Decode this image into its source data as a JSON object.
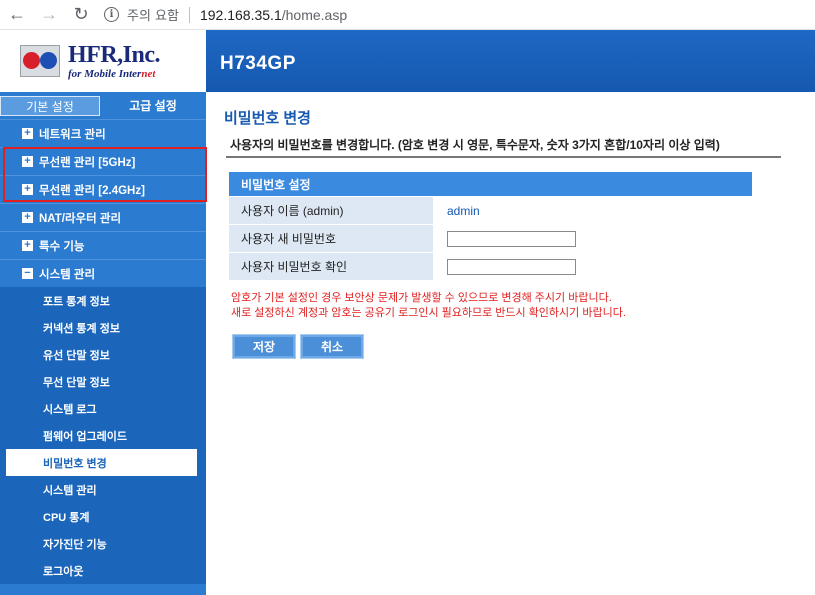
{
  "browser": {
    "security_label": "주의 요함",
    "url_host": "192.168.35.1",
    "url_path": "/home.asp"
  },
  "header": {
    "brand_name": "HFR,Inc.",
    "brand_tagline": "for Mobile Inter",
    "brand_tagline_accent": "net",
    "model": "H734GP"
  },
  "sidebar": {
    "tab_basic": "기본 설정",
    "tab_advanced": "고급 설정",
    "menu": [
      {
        "label": "네트워크 관리"
      },
      {
        "label": "무선랜 관리 [5GHz]"
      },
      {
        "label": "무선랜 관리 [2.4GHz]"
      },
      {
        "label": "NAT/라우터 관리"
      },
      {
        "label": "특수 기능"
      },
      {
        "label": "시스템 관리"
      }
    ],
    "submenu": [
      {
        "label": "포트 통계 정보"
      },
      {
        "label": "커넥션 통계 정보"
      },
      {
        "label": "유선 단말 정보"
      },
      {
        "label": "무선 단말 정보"
      },
      {
        "label": "시스템 로그"
      },
      {
        "label": "펌웨어 업그레이드"
      },
      {
        "label": "비밀번호 변경"
      },
      {
        "label": "시스템 관리"
      },
      {
        "label": "CPU 통계"
      },
      {
        "label": "자가진단 기능"
      },
      {
        "label": "로그아웃"
      }
    ],
    "active_submenu": "비밀번호 변경"
  },
  "main": {
    "title": "비밀번호 변경",
    "description": "사용자의 비밀번호를 변경합니다. (암호 변경 시 영문, 특수문자, 숫자 3가지 혼합/10자리 이상 입력)",
    "section_title": "비밀번호 설정",
    "rows": [
      {
        "label": "사용자 이름 (admin)",
        "value": "admin"
      },
      {
        "label": "사용자 새 비밀번호",
        "value": ""
      },
      {
        "label": "사용자 비밀번호 확인",
        "value": ""
      }
    ],
    "warning_1": "암호가 기본 설정인 경우 보안상 문제가 발생할 수 있으므로 변경해 주시기 바랍니다.",
    "warning_2": "새로 설정하신 계정과 암호는 공유기 로그인시 필요하므로 반드시 확인하시기 바랍니다.",
    "save_label": "저장",
    "cancel_label": "취소"
  },
  "colors": {
    "header_blue": "#1558b0",
    "sidebar_blue": "#2b7bd0",
    "submenu_blue": "#1b66bb",
    "warning_red": "#e02020"
  }
}
